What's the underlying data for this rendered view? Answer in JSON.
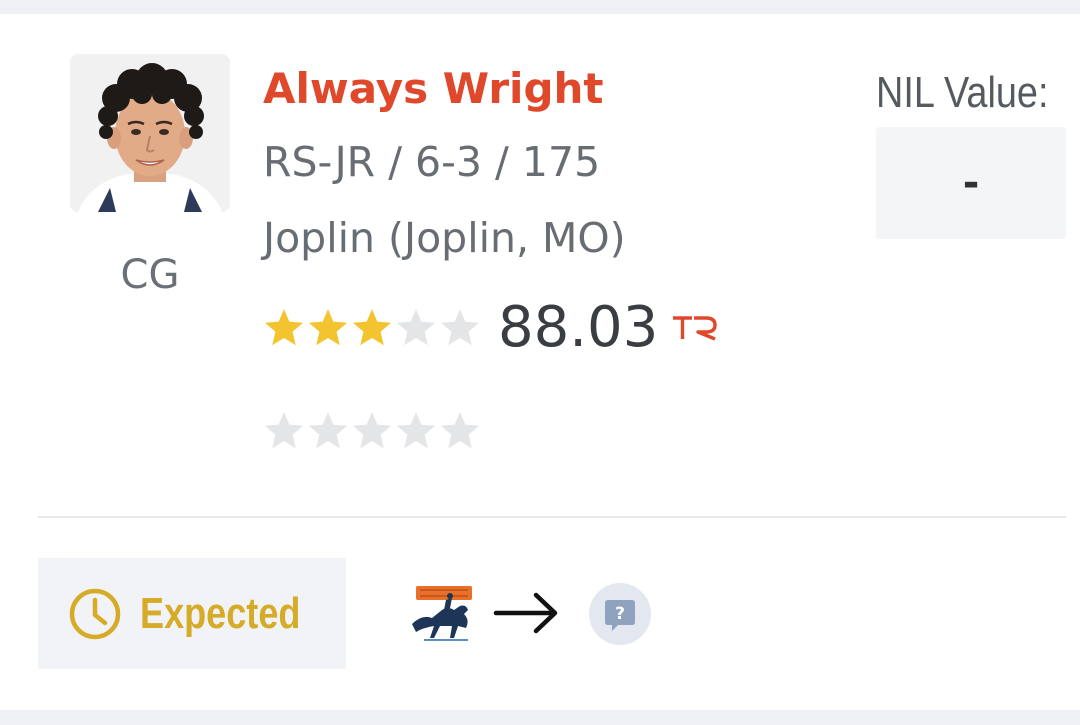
{
  "player": {
    "name": "Always Wright",
    "details": "RS-JR / 6-3 / 175",
    "school": "Joplin (Joplin, MO)",
    "position": "CG",
    "avatar_icon": "player-headshot",
    "rating_stars": 3,
    "rating_max_stars": 5,
    "rating_value": "88.03",
    "rating_source_icon": "TR",
    "secondary_stars": 0,
    "secondary_max_stars": 5
  },
  "nil": {
    "label": "NIL Value:",
    "value": "-"
  },
  "transfer": {
    "status_label": "Expected",
    "status_icon": "clock-icon",
    "from_team_logo": "UTRGV",
    "arrow_icon": "arrow-right-icon",
    "to_team_icon": "question-icon"
  },
  "colors": {
    "name": "#e0482b",
    "star_filled": "#f4c430",
    "star_empty": "#e4e5e7",
    "status": "#d6ab27",
    "tr_logo": "#e0482b"
  }
}
